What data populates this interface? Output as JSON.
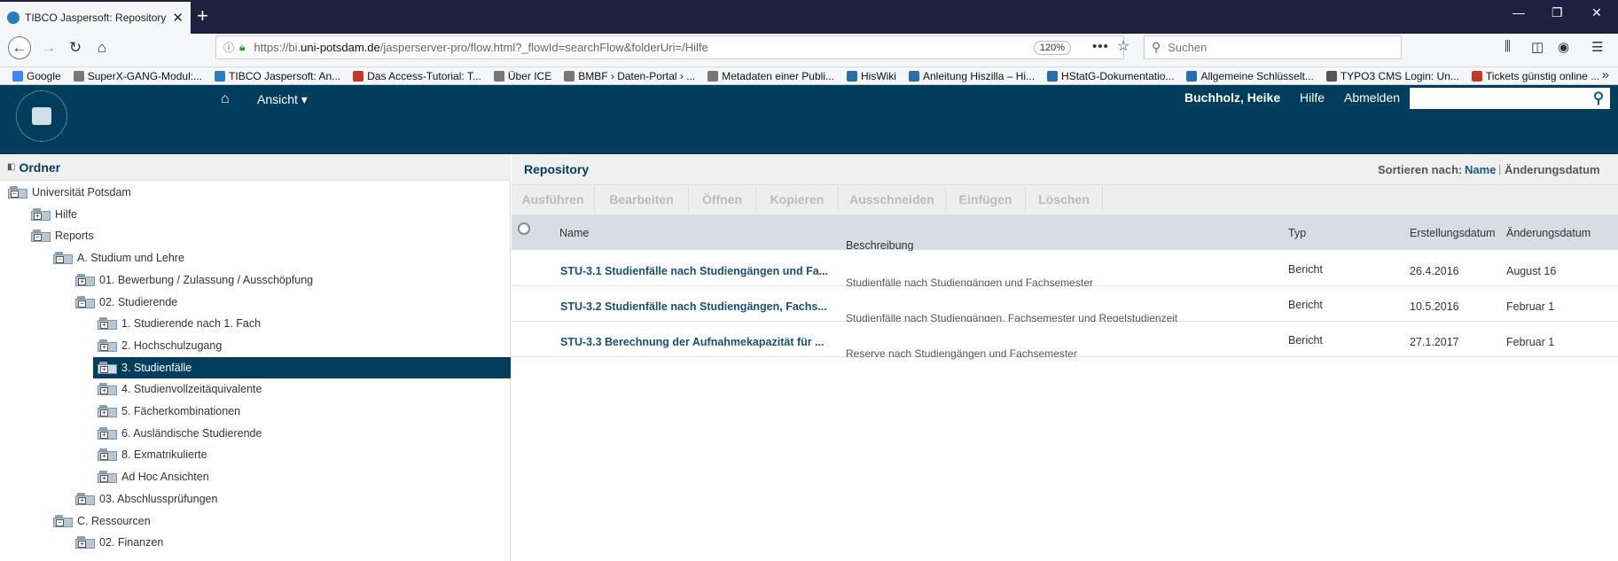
{
  "browser": {
    "tab_title": "TIBCO Jaspersoft: Repository d",
    "url_prefix": "https://bi.",
    "url_domain": "uni-potsdam.de",
    "url_rest": "/jasperserver-pro/flow.html?_flowId=searchFlow&folderUri=/Hilfe",
    "zoom": "120%",
    "search_placeholder": "Suchen",
    "bookmarks": [
      {
        "label": "Google",
        "color": "#4285f4"
      },
      {
        "label": "SuperX-GANG-Modul:...",
        "color": "#777777"
      },
      {
        "label": "TIBCO Jaspersoft: An...",
        "color": "#2c7cc0"
      },
      {
        "label": "Das Access-Tutorial: T...",
        "color": "#c0392b"
      },
      {
        "label": "Über ICE",
        "color": "#777777"
      },
      {
        "label": "BMBF › Daten-Portal › ...",
        "color": "#777777"
      },
      {
        "label": "Metadaten einer Publi...",
        "color": "#777777"
      },
      {
        "label": "HisWiki",
        "color": "#2a6cb0"
      },
      {
        "label": "Anleitung Hiszilla – Hi...",
        "color": "#2a6cb0"
      },
      {
        "label": "HStatG-Dokumentatio...",
        "color": "#2a6cb0"
      },
      {
        "label": "Allgemeine Schlüsselt...",
        "color": "#2a6cb0"
      },
      {
        "label": "TYPO3 CMS Login: Un...",
        "color": "#555555"
      },
      {
        "label": "Tickets günstig online ...",
        "color": "#c0392b"
      }
    ]
  },
  "header": {
    "menu_view": "Ansicht ▾",
    "user": "Buchholz, Heike",
    "help": "Hilfe",
    "logout": "Abmelden"
  },
  "left_panel": {
    "title": "Ordner",
    "tree": [
      {
        "label": "Universität Potsdam",
        "level": 0,
        "sign": "−"
      },
      {
        "label": "Hilfe",
        "level": 1,
        "sign": "+"
      },
      {
        "label": "Reports",
        "level": 1,
        "sign": "−"
      },
      {
        "label": "A. Studium und Lehre",
        "level": 2,
        "sign": "−"
      },
      {
        "label": "01. Bewerbung / Zulassung / Ausschöpfung",
        "level": 3,
        "sign": "+"
      },
      {
        "label": "02. Studierende",
        "level": 3,
        "sign": "−"
      },
      {
        "label": "1. Studierende nach 1. Fach",
        "level": 4,
        "sign": "+"
      },
      {
        "label": "2. Hochschulzugang",
        "level": 4,
        "sign": "+"
      },
      {
        "label": "3. Studienfälle",
        "level": 4,
        "sign": "+",
        "selected": true
      },
      {
        "label": "4. Studienvollzeitäquivalente",
        "level": 4,
        "sign": "+"
      },
      {
        "label": "5. Fächerkombinationen",
        "level": 4,
        "sign": "+"
      },
      {
        "label": "6. Ausländische Studierende",
        "level": 4,
        "sign": "+"
      },
      {
        "label": "8. Exmatrikulierte",
        "level": 4,
        "sign": "+"
      },
      {
        "label": "Ad Hoc Ansichten",
        "level": 4,
        "sign": "+"
      },
      {
        "label": "03. Abschlussprüfungen",
        "level": 3,
        "sign": "+"
      },
      {
        "label": "C. Ressourcen",
        "level": 2,
        "sign": "−"
      },
      {
        "label": "02. Finanzen",
        "level": 3,
        "sign": "+"
      }
    ]
  },
  "repository": {
    "title": "Repository",
    "sort_label": "Sortieren nach:",
    "sort_name": "Name",
    "sort_sep": "|",
    "sort_date": "Änderungsdatum",
    "toolbar": [
      "Ausführen",
      "Bearbeiten",
      "Öffnen",
      "Kopieren",
      "Ausschneiden",
      "Einfügen",
      "Löschen"
    ],
    "columns": {
      "name": "Name",
      "description": "Beschreibung",
      "type": "Typ",
      "created": "Erstellungsdatum",
      "modified": "Änderungsdatum"
    },
    "rows": [
      {
        "name": "STU-3.1 Studienfälle nach Studiengängen und Fa...",
        "description": "Studienfälle nach Studiengängen und Fachsemester",
        "type": "Bericht",
        "created": "26.4.2016",
        "modified": "August 16"
      },
      {
        "name": "STU-3.2 Studienfälle nach Studiengängen, Fachs...",
        "description": "Studienfälle nach Studiengängen, Fachsemester und Regelstudienzeit",
        "type": "Bericht",
        "created": "10.5.2016",
        "modified": "Februar 1"
      },
      {
        "name": "STU-3.3 Berechnung der Aufnahmekapazität für ...",
        "description": "Reserve nach Studiengängen und Fachsemester",
        "type": "Bericht",
        "created": "27.1.2017",
        "modified": "Februar 1"
      }
    ]
  }
}
